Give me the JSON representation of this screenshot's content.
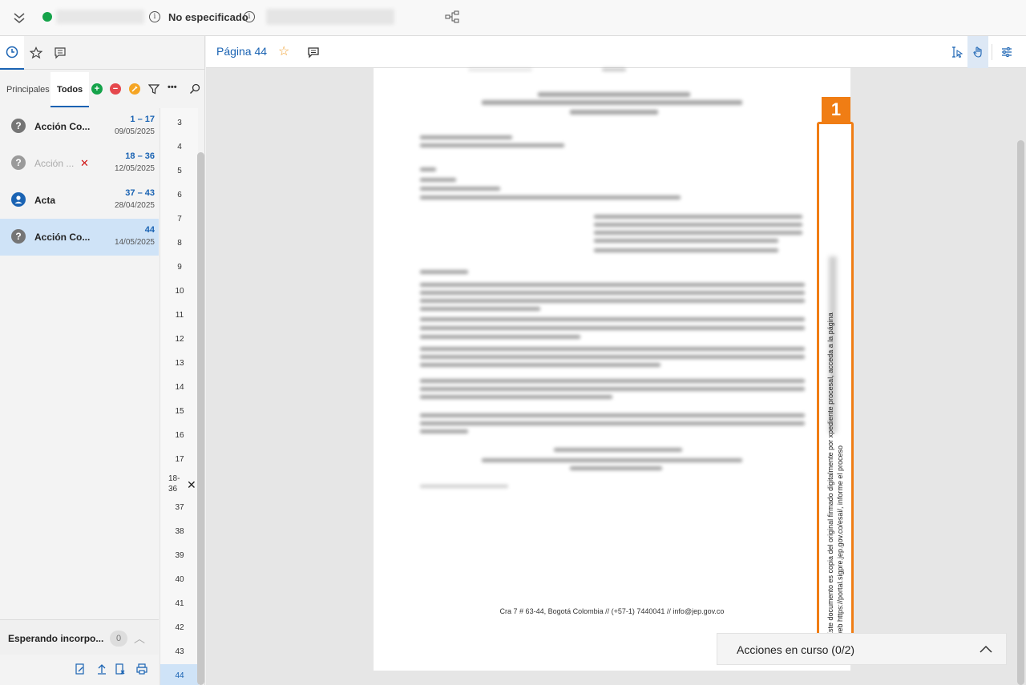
{
  "topbar": {
    "status_label": "No especificado",
    "info_glyph": "i"
  },
  "left_tabs": [
    "history-icon",
    "star-icon",
    "comment-icon"
  ],
  "filters": {
    "tab_principales": "Principales",
    "tab_todos": "Todos",
    "add_glyph": "+",
    "remove_glyph": "−",
    "more_glyph": "•••"
  },
  "documents": [
    {
      "title": "Acción Co...",
      "range": "1 – 17",
      "date": "09/05/2025",
      "icon": "question-icon"
    },
    {
      "title": "Acción ...",
      "range": "18 – 36",
      "date": "12/05/2025",
      "icon": "question-icon",
      "removed": true,
      "remove_mark": "✕"
    },
    {
      "title": "Acta",
      "range": "37 – 43",
      "date": "28/04/2025",
      "icon": "person-icon"
    },
    {
      "title": "Acción Co...",
      "range": "44",
      "date": "14/05/2025",
      "icon": "question-icon",
      "selected": true
    }
  ],
  "doc_icon_glyphs": {
    "question": "?",
    "person": "⚉"
  },
  "page_numbers": [
    "3",
    "4",
    "5",
    "6",
    "7",
    "8",
    "9",
    "10",
    "11",
    "12",
    "13",
    "14",
    "15",
    "16",
    "17",
    "18-\n36",
    "37",
    "38",
    "39",
    "40",
    "41",
    "42",
    "43",
    "44"
  ],
  "page_group_close": "✕",
  "waiting": {
    "label": "Esperando incorpo...",
    "count": "0",
    "chevron": "︿"
  },
  "viewer": {
    "page_title": "Página 44",
    "star_glyph": "☆",
    "footer": "Cra 7 # 63-44, Bogotá Colombia // (+57-1) 7440041 // info@jep.gov.co",
    "stamp_number": "1",
    "stamp_line1": "Este documento es copia del original firmado digitalmente por                                                  xpediente procesal, acceda a la página",
    "stamp_line2": "web https://portal.sigpre.jep.gov.co/esai/, informe el proceso",
    "actions_label": "Acciones en curso (0/2)"
  }
}
